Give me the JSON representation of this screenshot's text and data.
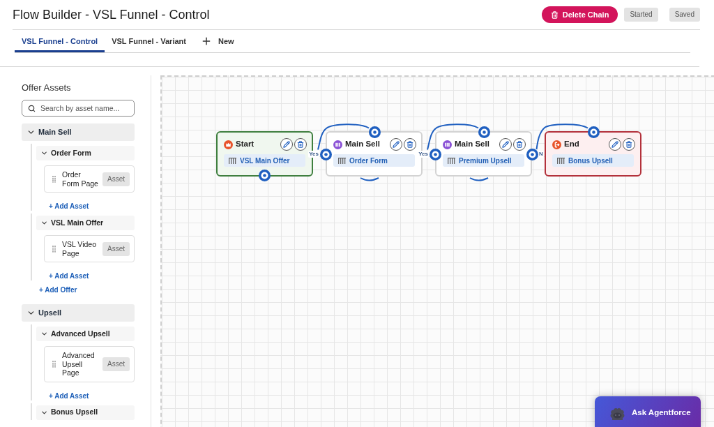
{
  "header": {
    "title": "Flow Builder - VSL Funnel - Control",
    "delete_button": {
      "label": "Delete Chain"
    },
    "status_badges": [
      "Started",
      "Saved"
    ]
  },
  "tabs": [
    {
      "label": "VSL Funnel - Control",
      "selected": true
    },
    {
      "label": "VSL Funnel - Variant",
      "selected": false
    }
  ],
  "new_tab": {
    "label": "New"
  },
  "sidebar": {
    "title": "Offer Assets",
    "search": {
      "placeholder": "Search by asset name..."
    },
    "groups": [
      {
        "label": "Main Sell",
        "expanded": true,
        "children": [
          {
            "label": "Order Form",
            "expanded": true,
            "children": [
              {
                "label": "Order Form Page",
                "badge": "Asset"
              }
            ],
            "add_label": "+ Add Asset"
          },
          {
            "label": "VSL Main Offer",
            "expanded": true,
            "children": [
              {
                "label": "VSL Video Page",
                "badge": "Asset"
              }
            ],
            "add_label": "+ Add Asset"
          }
        ],
        "add_label": "+ Add Offer"
      },
      {
        "label": "Upsell",
        "expanded": true,
        "children": [
          {
            "label": "Advanced Upsell",
            "expanded": true,
            "children": [
              {
                "label": "Advanced Upsell Page",
                "badge": "Asset"
              }
            ],
            "add_label": "+ Add Asset"
          },
          {
            "label": "Bonus Upsell",
            "expanded": true
          }
        ]
      }
    ]
  },
  "canvas": {
    "nodes": [
      {
        "kind": "start",
        "title": "Start",
        "offer": "VSL Main Offer"
      },
      {
        "kind": "step",
        "title": "Main Sell",
        "offer": "Order Form"
      },
      {
        "kind": "step",
        "title": "Main Sell",
        "offer": "Premium Upsell"
      },
      {
        "kind": "end",
        "title": "End",
        "offer": "Bonus Upsell"
      }
    ],
    "edges": [
      {
        "label": "Yes"
      },
      {
        "label": "Yes"
      },
      {
        "label": "N"
      }
    ]
  },
  "assistant_button": {
    "label": "Ask Agentforce"
  }
}
